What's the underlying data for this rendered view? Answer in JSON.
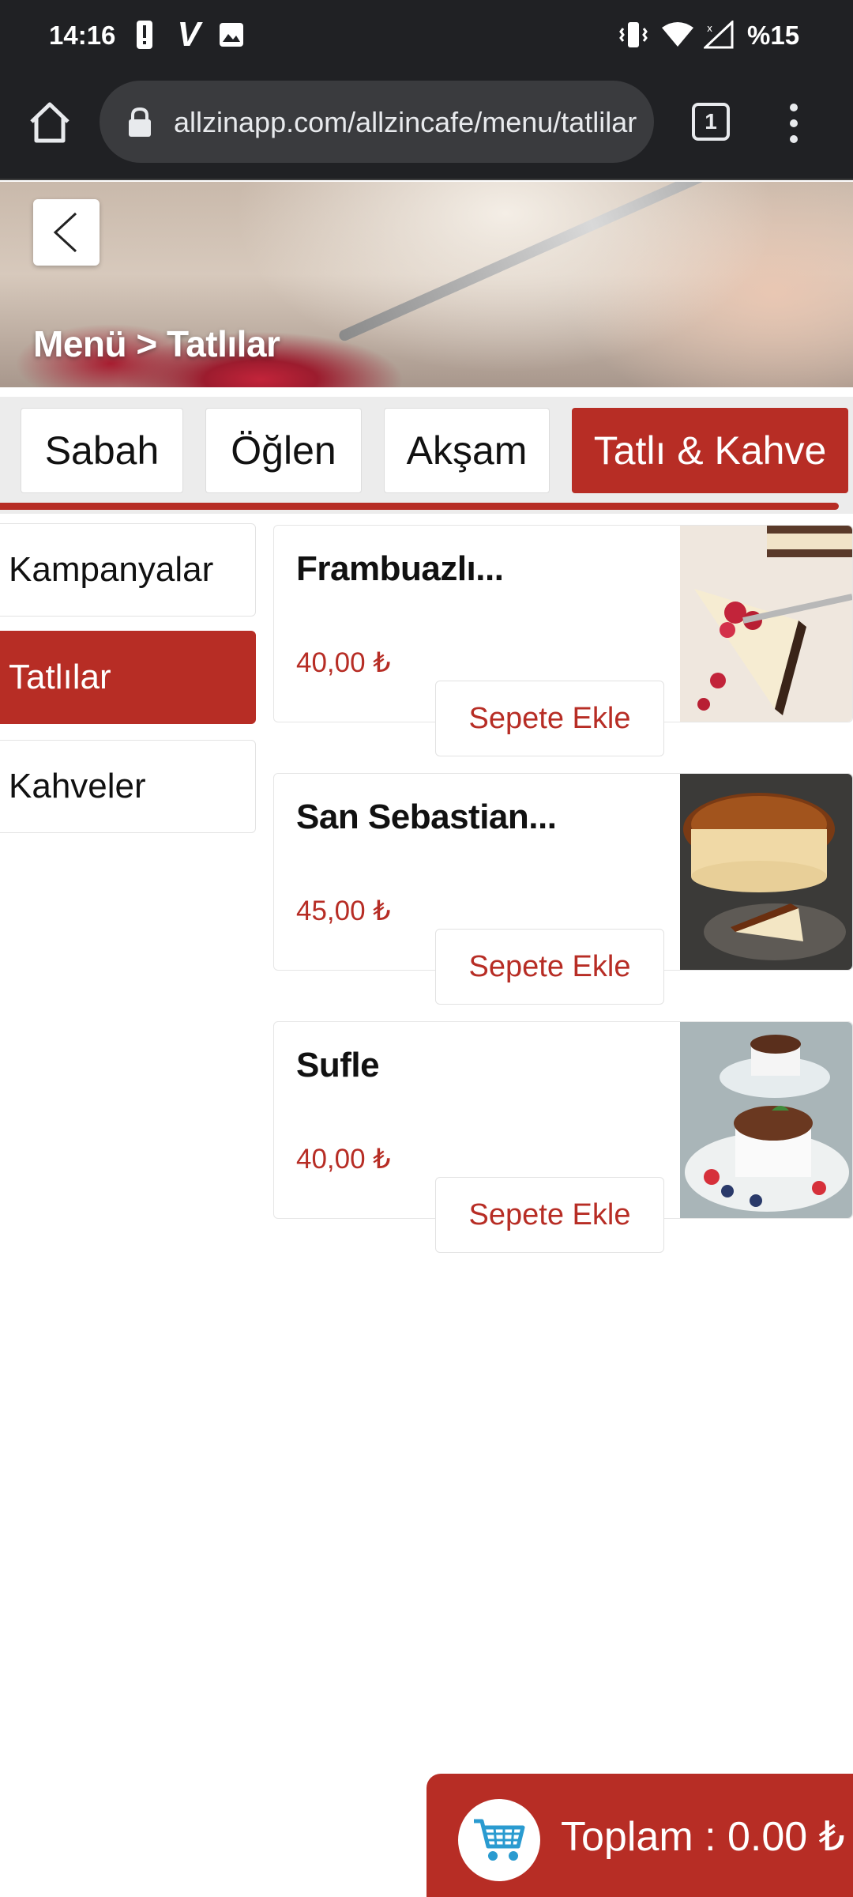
{
  "status_bar": {
    "time": "14:16",
    "battery": "%15",
    "icons": [
      "alert-icon",
      "v-app-icon",
      "image-icon",
      "vibrate-icon",
      "wifi-icon",
      "signal-icon"
    ]
  },
  "browser": {
    "url": "allzinapp.com/allzincafe/menu/tatlilar",
    "tab_count": "1"
  },
  "hero": {
    "breadcrumb": "Menü > Tatlılar"
  },
  "tabs": [
    {
      "label": "Sabah",
      "active": false
    },
    {
      "label": "Öğlen",
      "active": false
    },
    {
      "label": "Akşam",
      "active": false
    },
    {
      "label": "Tatlı & Kahve",
      "active": true
    }
  ],
  "sidebar": {
    "items": [
      {
        "label": "Kampanyalar",
        "active": false
      },
      {
        "label": "Tatlılar",
        "active": true
      },
      {
        "label": "Kahveler",
        "active": false
      }
    ]
  },
  "products": [
    {
      "name": "Frambuazlı...",
      "price": "40,00 ₺",
      "button": "Sepete Ekle",
      "image": "raspberry-cheesecake"
    },
    {
      "name": "San Sebastian...",
      "price": "45,00 ₺",
      "button": "Sepete Ekle",
      "image": "san-sebastian-cheesecake"
    },
    {
      "name": "Sufle",
      "price": "40,00 ₺",
      "button": "Sepete Ekle",
      "image": "chocolate-souffle"
    }
  ],
  "cart": {
    "total": "Toplam : 0.00 ₺"
  },
  "colors": {
    "accent": "#b72d25",
    "browser_bg": "#202124",
    "tabs_bg": "#ececec"
  }
}
